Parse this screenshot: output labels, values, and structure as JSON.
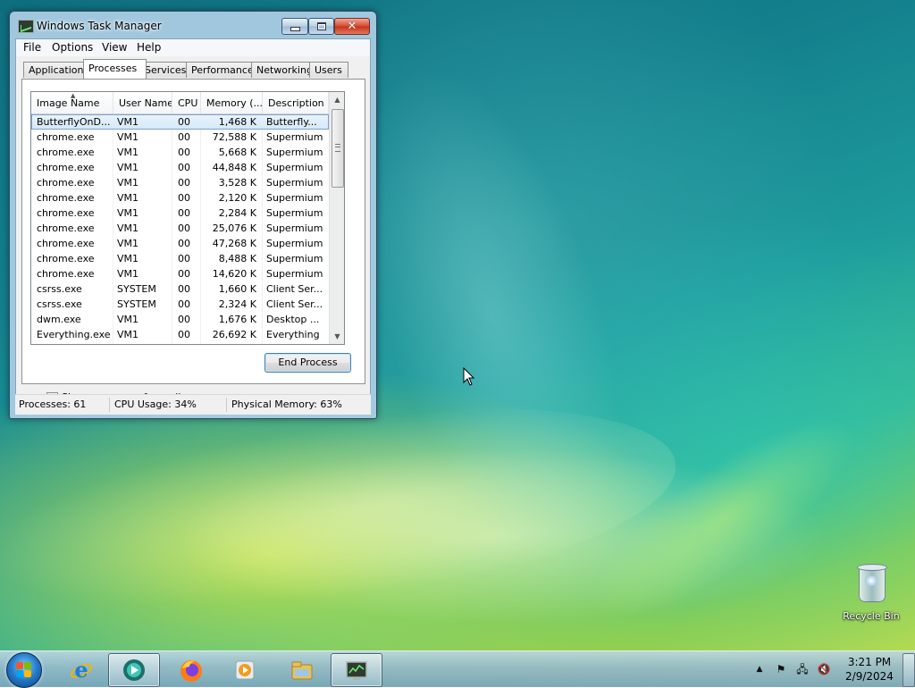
{
  "window": {
    "title": "Windows Task Manager",
    "menu": [
      "File",
      "Options",
      "View",
      "Help"
    ],
    "tabs": [
      "Applications",
      "Processes",
      "Services",
      "Performance",
      "Networking",
      "Users"
    ],
    "active_tab": "Processes",
    "columns": [
      "Image Name",
      "User Name",
      "CPU",
      "Memory (...",
      "Description"
    ],
    "processes": [
      {
        "name": "ButterflyOnD...",
        "user": "VM1",
        "cpu": "00",
        "mem": "1,468 K",
        "desc": "Butterfly..."
      },
      {
        "name": "chrome.exe",
        "user": "VM1",
        "cpu": "00",
        "mem": "72,588 K",
        "desc": "Supermium"
      },
      {
        "name": "chrome.exe",
        "user": "VM1",
        "cpu": "00",
        "mem": "5,668 K",
        "desc": "Supermium"
      },
      {
        "name": "chrome.exe",
        "user": "VM1",
        "cpu": "00",
        "mem": "44,848 K",
        "desc": "Supermium"
      },
      {
        "name": "chrome.exe",
        "user": "VM1",
        "cpu": "00",
        "mem": "3,528 K",
        "desc": "Supermium"
      },
      {
        "name": "chrome.exe",
        "user": "VM1",
        "cpu": "00",
        "mem": "2,120 K",
        "desc": "Supermium"
      },
      {
        "name": "chrome.exe",
        "user": "VM1",
        "cpu": "00",
        "mem": "2,284 K",
        "desc": "Supermium"
      },
      {
        "name": "chrome.exe",
        "user": "VM1",
        "cpu": "00",
        "mem": "25,076 K",
        "desc": "Supermium"
      },
      {
        "name": "chrome.exe",
        "user": "VM1",
        "cpu": "00",
        "mem": "47,268 K",
        "desc": "Supermium"
      },
      {
        "name": "chrome.exe",
        "user": "VM1",
        "cpu": "00",
        "mem": "8,488 K",
        "desc": "Supermium"
      },
      {
        "name": "chrome.exe",
        "user": "VM1",
        "cpu": "00",
        "mem": "14,620 K",
        "desc": "Supermium"
      },
      {
        "name": "csrss.exe",
        "user": "SYSTEM",
        "cpu": "00",
        "mem": "1,660 K",
        "desc": "Client Ser..."
      },
      {
        "name": "csrss.exe",
        "user": "SYSTEM",
        "cpu": "00",
        "mem": "2,324 K",
        "desc": "Client Ser..."
      },
      {
        "name": "dwm.exe",
        "user": "VM1",
        "cpu": "00",
        "mem": "1,676 K",
        "desc": "Desktop ..."
      },
      {
        "name": "Everything.exe",
        "user": "VM1",
        "cpu": "00",
        "mem": "26,692 K",
        "desc": "Everything"
      }
    ],
    "selected_index": 0,
    "show_all_label": "Show processes from all users",
    "show_all_checked": true,
    "end_process_label": "End Process",
    "status": {
      "processes": "Processes: 61",
      "cpu": "CPU Usage: 34%",
      "memory": "Physical Memory: 63%"
    }
  },
  "desktop": {
    "recycle_bin_label": "Recycle Bin"
  },
  "taskbar": {
    "pinned": [
      "internet-explorer-icon",
      "media-center-icon",
      "firefox-icon",
      "media-player-icon",
      "file-explorer-icon",
      "task-manager-icon"
    ],
    "clock_time": "3:21 PM",
    "clock_date": "2/9/2024"
  },
  "colors": {
    "selection": "#d4e8fb",
    "start_orb": "#2379c9",
    "close_button": "#c3321b"
  }
}
